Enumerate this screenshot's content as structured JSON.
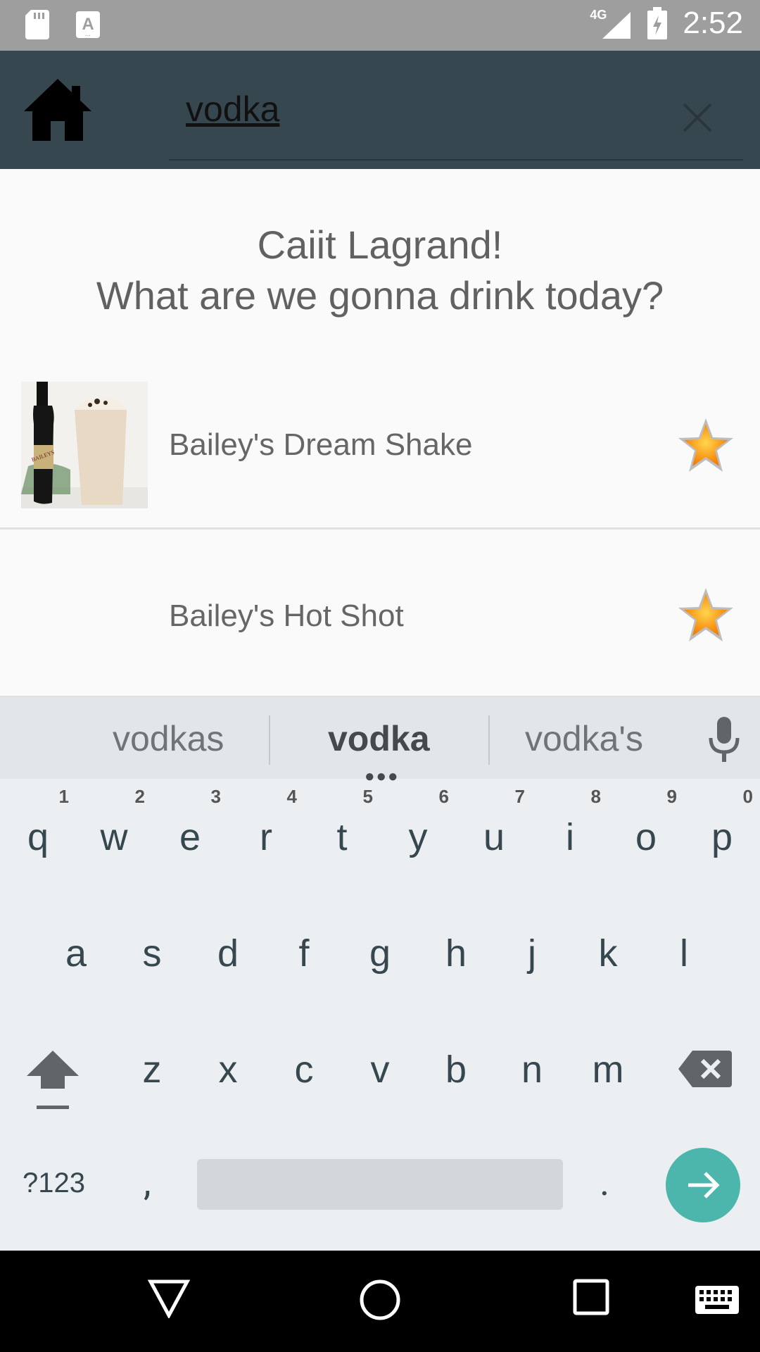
{
  "status_bar": {
    "time": "2:52",
    "network": "4G",
    "icons": [
      "sd-card-icon",
      "font-a-icon",
      "signal-icon",
      "battery-charging-icon"
    ]
  },
  "toolbar": {
    "home_icon": "home-icon",
    "search_value": "vodka",
    "clear_icon": "close-icon"
  },
  "greeting": {
    "line1": "Caiit Lagrand!",
    "line2": "What are we gonna drink today?"
  },
  "results": [
    {
      "title": "Bailey's Dream Shake",
      "has_image": true,
      "favorite_icon": "star-icon"
    },
    {
      "title": "Bailey's Hot Shot",
      "has_image": false,
      "favorite_icon": "star-icon"
    }
  ],
  "keyboard": {
    "suggestions": [
      "vodkas",
      "vodka",
      "vodka's"
    ],
    "row1": [
      {
        "k": "q",
        "n": "1"
      },
      {
        "k": "w",
        "n": "2"
      },
      {
        "k": "e",
        "n": "3"
      },
      {
        "k": "r",
        "n": "4"
      },
      {
        "k": "t",
        "n": "5"
      },
      {
        "k": "y",
        "n": "6"
      },
      {
        "k": "u",
        "n": "7"
      },
      {
        "k": "i",
        "n": "8"
      },
      {
        "k": "o",
        "n": "9"
      },
      {
        "k": "p",
        "n": "0"
      }
    ],
    "row2": [
      "a",
      "s",
      "d",
      "f",
      "g",
      "h",
      "j",
      "k",
      "l"
    ],
    "row3": [
      "z",
      "x",
      "c",
      "v",
      "b",
      "n",
      "m"
    ],
    "symbols_label": "?123",
    "comma": ",",
    "period": ".",
    "accent_color": "#4db6ac"
  },
  "colors": {
    "toolbar": "#37474f",
    "status_bar": "#9e9e9e",
    "background": "#fafafa"
  }
}
